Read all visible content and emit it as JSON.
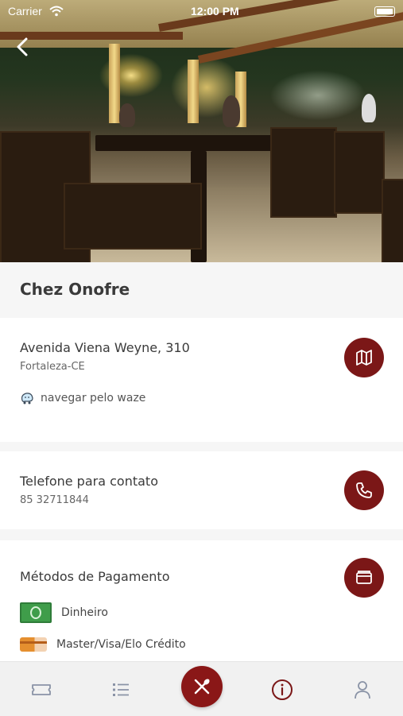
{
  "status_bar": {
    "carrier": "Carrier",
    "time": "12:00 PM"
  },
  "restaurant": {
    "name": "Chez Onofre"
  },
  "address": {
    "street": "Avenida Viena Weyne, 310",
    "city": "Fortaleza-CE",
    "waze_label": "navegar pelo waze",
    "map_icon": "map-icon"
  },
  "contact": {
    "label": "Telefone para contato",
    "phone": "85 32711844",
    "phone_icon": "phone-icon"
  },
  "payment": {
    "title": "Métodos de Pagamento",
    "methods": [
      {
        "label": "Dinheiro",
        "icon": "cash-icon"
      },
      {
        "label": "Master/Visa/Elo Crédito",
        "icon": "credit-card-icon"
      }
    ],
    "wallet_icon": "wallet-icon"
  },
  "tabbar": {
    "items": [
      {
        "name": "ticket-icon"
      },
      {
        "name": "list-icon"
      },
      {
        "name": "restaurant-icon",
        "active": true
      },
      {
        "name": "info-icon",
        "selected": true
      },
      {
        "name": "profile-icon"
      }
    ]
  },
  "colors": {
    "accent": "#7b1717",
    "text": "#3a3a3a",
    "muted": "#666666"
  }
}
